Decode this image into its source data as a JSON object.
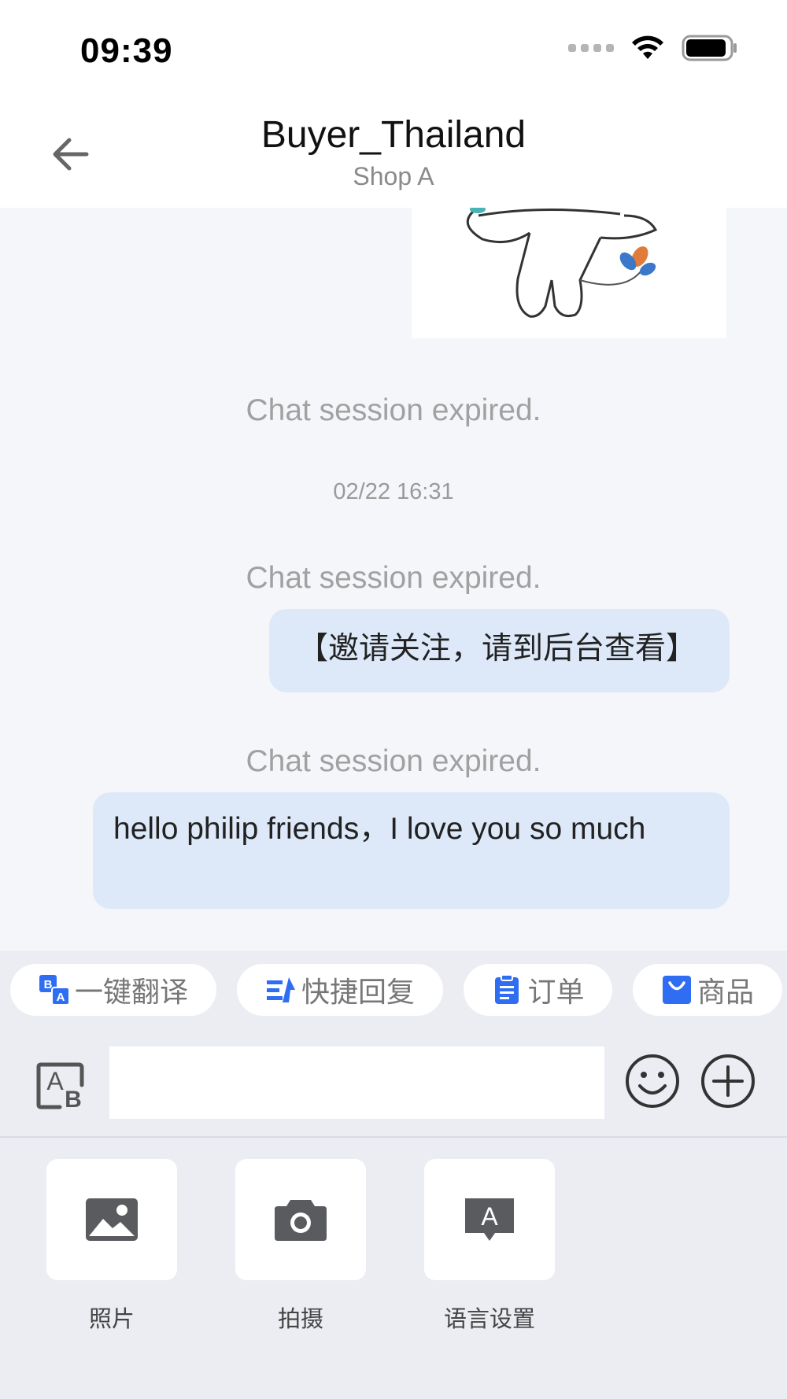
{
  "status_bar": {
    "time": "09:39"
  },
  "header": {
    "title": "Buyer_Thailand",
    "subtitle": "Shop A"
  },
  "chat": {
    "system_msg_1": "Chat session expired.",
    "timestamp": "02/22 16:31",
    "system_msg_2": "Chat session expired.",
    "bubble_1": "【邀请关注，请到后台查看】",
    "system_msg_3": "Chat session expired.",
    "bubble_2": "hello philip friends，I love you so much"
  },
  "quick_actions": [
    {
      "label": "一键翻译",
      "icon": "translate-icon"
    },
    {
      "label": "快捷回复",
      "icon": "quick-reply-icon"
    },
    {
      "label": "订单",
      "icon": "order-icon"
    },
    {
      "label": "商品",
      "icon": "product-bag-icon"
    }
  ],
  "input": {
    "value": "",
    "placeholder": ""
  },
  "tools": [
    {
      "label": "照片",
      "icon": "image-icon"
    },
    {
      "label": "拍摄",
      "icon": "camera-icon"
    },
    {
      "label": "语言设置",
      "icon": "language-setting-icon"
    }
  ],
  "colors": {
    "accent": "#2f6ef2",
    "bubble": "#dde9f9",
    "panel": "#ebedf3",
    "chat_bg": "#f5f6f9"
  }
}
